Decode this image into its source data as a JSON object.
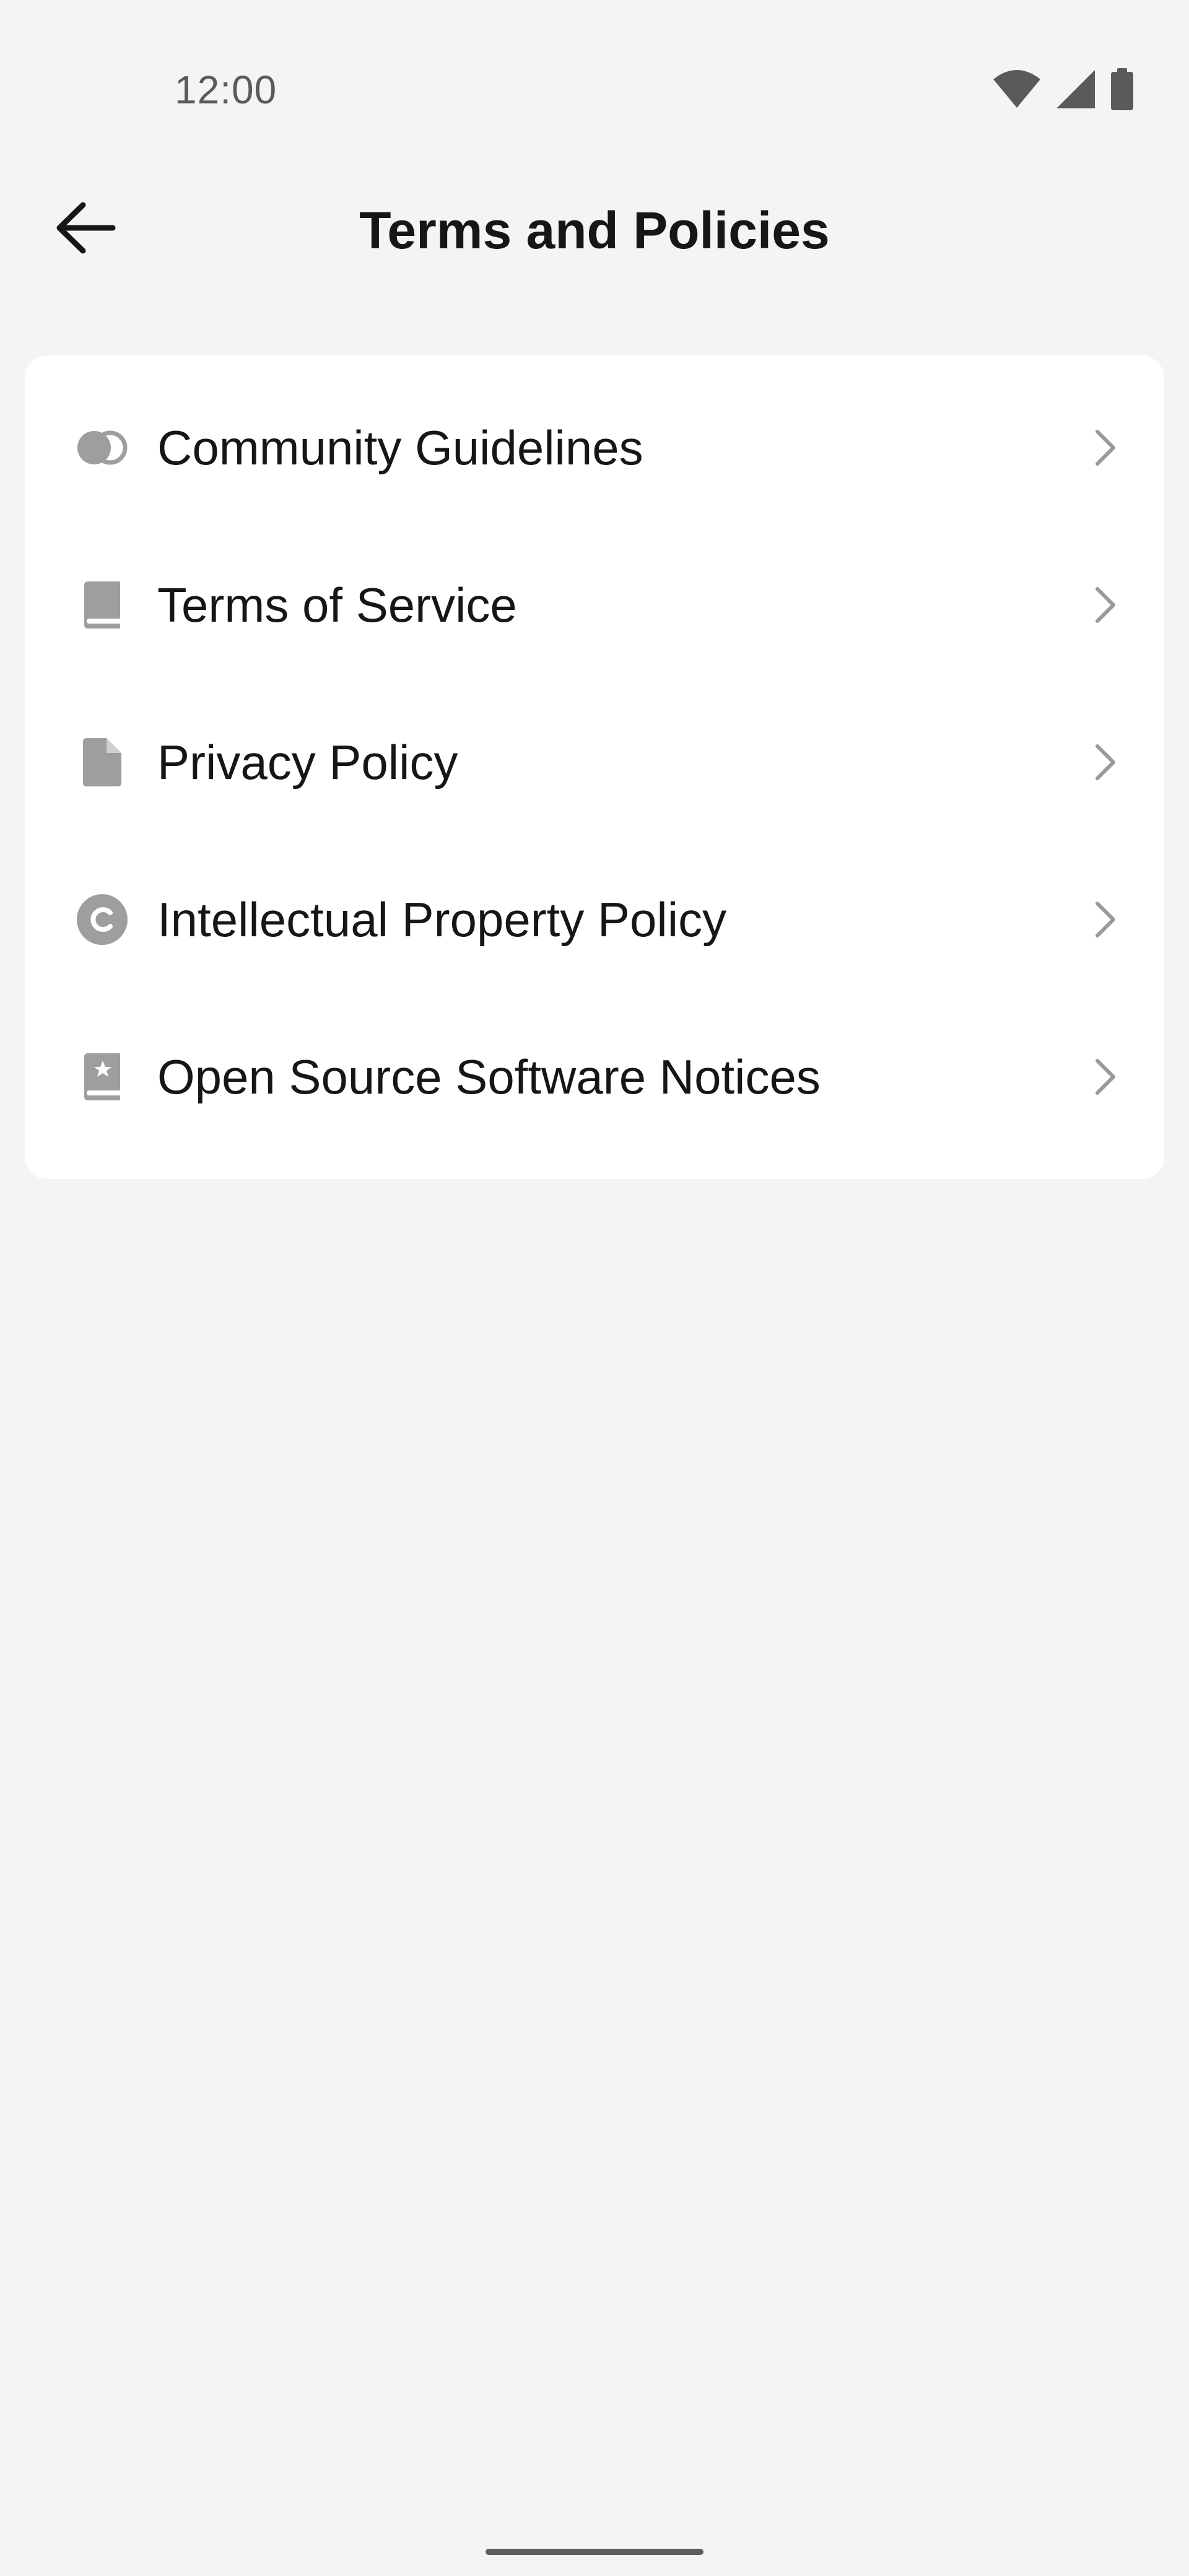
{
  "status_bar": {
    "time": "12:00",
    "icons": [
      "wifi-icon",
      "signal-icon",
      "battery-icon"
    ]
  },
  "header": {
    "back_icon": "arrow-left-icon",
    "title": "Terms and Policies"
  },
  "menu": {
    "items": [
      {
        "label": "Community Guidelines",
        "icon": "toggle-circles-icon"
      },
      {
        "label": "Terms of Service",
        "icon": "book-icon"
      },
      {
        "label": "Privacy Policy",
        "icon": "document-icon"
      },
      {
        "label": "Intellectual Property Policy",
        "icon": "copyright-icon"
      },
      {
        "label": "Open Source Software Notices",
        "icon": "star-book-icon"
      }
    ],
    "chevron_icon": "chevron-right-icon"
  },
  "colors": {
    "background": "#f4f4f4",
    "card": "#ffffff",
    "text": "#161616",
    "icon": "#9e9e9e",
    "chevron": "#9a9a9a",
    "status_text": "#5a5a5a"
  }
}
